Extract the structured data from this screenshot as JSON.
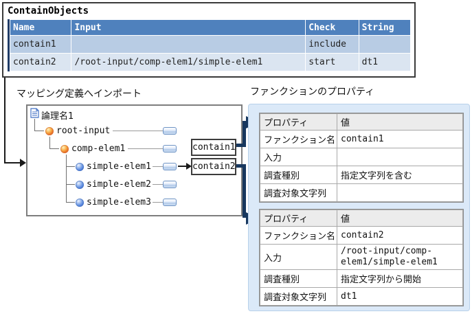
{
  "contain_objects": {
    "title": "ContainObjects",
    "columns": [
      "Name",
      "Input",
      "Check",
      "String"
    ],
    "rows": [
      [
        "contain1",
        "",
        "include",
        ""
      ],
      [
        "contain2",
        "/root-input/comp-elem1/simple-elem1",
        "start",
        "dt1"
      ]
    ]
  },
  "mapping": {
    "label": "マッピング定義へインポート",
    "tree": {
      "root_label": "論理名1",
      "nodes": [
        {
          "name": "root-input",
          "icon": "element-icon-orange"
        },
        {
          "name": "comp-elem1",
          "icon": "element-icon-orange"
        },
        {
          "name": "simple-elem1",
          "icon": "element-icon-blue"
        },
        {
          "name": "simple-elem2",
          "icon": "element-icon-blue"
        },
        {
          "name": "simple-elem3",
          "icon": "element-icon-blue"
        }
      ]
    },
    "function_boxes": [
      "contain1",
      "contain2"
    ]
  },
  "properties_panel": {
    "label": "ファンクションのプロパティ",
    "tables": [
      {
        "header": [
          "プロパティ",
          "値"
        ],
        "rows": [
          [
            "ファンクション名",
            "contain1"
          ],
          [
            "入力",
            ""
          ],
          [
            "調査種別",
            "指定文字列を含む"
          ],
          [
            "調査対象文字列",
            ""
          ]
        ]
      },
      {
        "header": [
          "プロパティ",
          "値"
        ],
        "rows": [
          [
            "ファンクション名",
            "contain2"
          ],
          [
            "入力",
            "/root-input/comp-elem1/simple-elem1"
          ],
          [
            "調査種別",
            "指定文字列から開始"
          ],
          [
            "調査対象文字列",
            "dt1"
          ]
        ]
      }
    ]
  },
  "colors": {
    "table_header_blue": "#4f81bd",
    "table_row_blue_1": "#b8cce4",
    "table_row_blue_2": "#dbe5f1",
    "navy_connector": "#17375e",
    "panel_blue": "#dbe9f8"
  }
}
